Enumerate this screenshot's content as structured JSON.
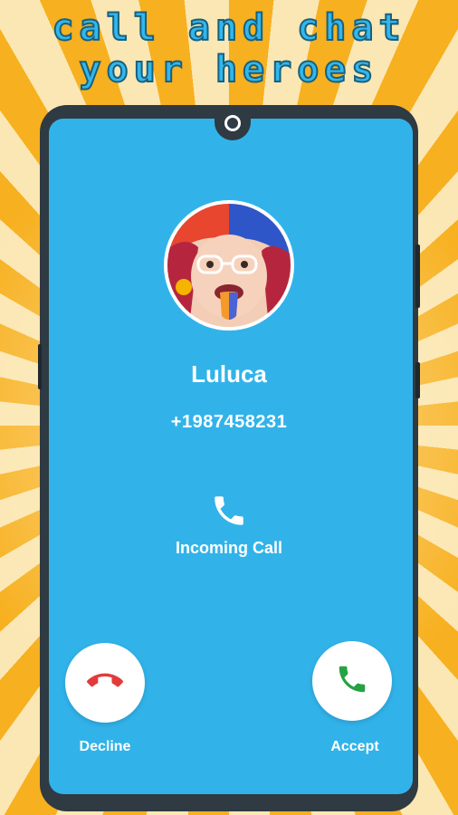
{
  "promo": {
    "line1": "CALL AND CHAT",
    "line2": "YOUR HEROES"
  },
  "caller": {
    "name": "Luluca",
    "number": "+1987458231",
    "status": "Incoming Call"
  },
  "actions": {
    "decline_label": "Decline",
    "accept_label": "Accept"
  },
  "icons": {
    "status": "phone-icon",
    "decline": "phone-hangup-icon",
    "accept": "phone-icon"
  },
  "colors": {
    "screen_bg": "#31b3ea",
    "promo_text": "#32b7ec",
    "decline_icon": "#e23b3b",
    "accept_icon": "#25a244",
    "background_ray_dark": "#f7b01f",
    "background_ray_light": "#fbe7b4"
  }
}
